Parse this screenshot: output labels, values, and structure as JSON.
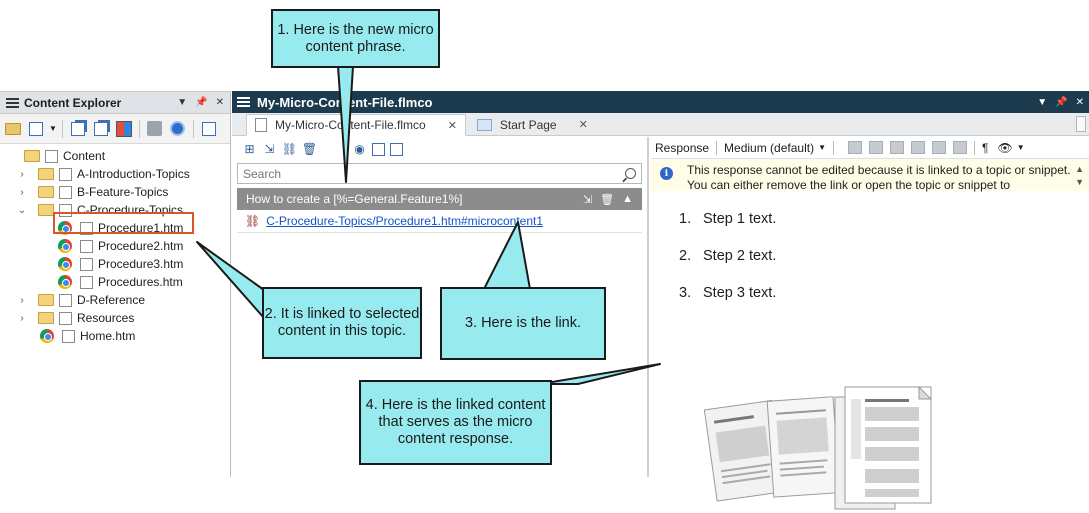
{
  "explorer": {
    "title": "Content Explorer",
    "tree": [
      {
        "label": "Content",
        "depth": 0
      },
      {
        "label": "A-Introduction-Topics",
        "depth": 1
      },
      {
        "label": "B-Feature-Topics",
        "depth": 1
      },
      {
        "label": "C-Procedure-Topics",
        "depth": 1
      },
      {
        "label": "Procedure1.htm",
        "depth": 2
      },
      {
        "label": "Procedure2.htm",
        "depth": 2
      },
      {
        "label": "Procedure3.htm",
        "depth": 2
      },
      {
        "label": "Procedures.htm",
        "depth": 2
      },
      {
        "label": "D-Reference",
        "depth": 1
      },
      {
        "label": "Resources",
        "depth": 1
      },
      {
        "label": "Home.htm",
        "depth": 1
      }
    ]
  },
  "main": {
    "title": "My-Micro-Content-File.flmco",
    "tabs": [
      {
        "label": "My-Micro-Content-File.flmco",
        "close": "✕"
      },
      {
        "label": "Start Page",
        "close": "✕"
      }
    ],
    "search_placeholder": "Search",
    "phrase": "How to create a [%=General.Feature1%]",
    "link": "C-Procedure-Topics/Procedure1.htm#microcontent1",
    "response_toolbar": {
      "response_label": "Response",
      "medium_label": "Medium (default)",
      "pilcrow": "¶"
    },
    "notice": "This response cannot be edited because it is linked to a topic or snippet. You can either remove the link or open the topic or snippet to",
    "steps": [
      {
        "num": "1.",
        "text": "Step 1 text."
      },
      {
        "num": "2.",
        "text": "Step 2 text."
      },
      {
        "num": "3.",
        "text": "Step 3 text."
      }
    ]
  },
  "callouts": {
    "c1": "1. Here is the new micro content phrase.",
    "c2": "2. It is linked to selected content in this topic.",
    "c3": "3. Here is the link.",
    "c4": "4. Here is the linked content that serves as the micro content response."
  },
  "colors": {
    "callout": "#97ebef",
    "title_bar": "#1c3b4e",
    "selection_border": "#d9542b",
    "link": "#1155cc"
  }
}
